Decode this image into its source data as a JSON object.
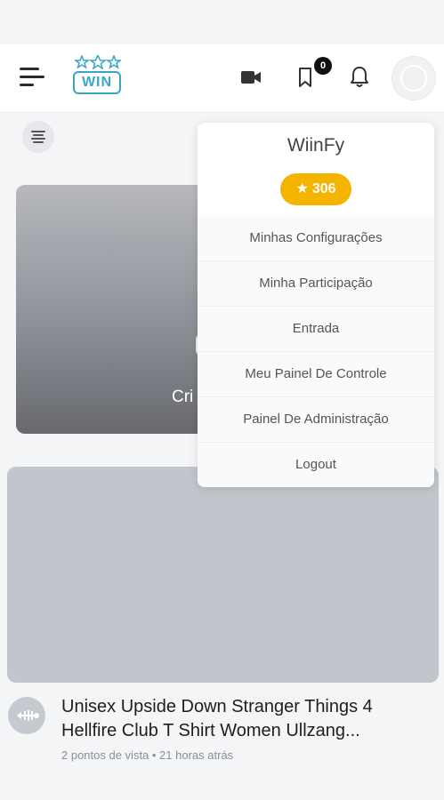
{
  "header": {
    "logo_text": "WIN",
    "notification_count": "0"
  },
  "feed": {
    "card1_text": "Cri",
    "post": {
      "title": "Unisex Upside Down Stranger Things 4 Hellfire Club T Shirt Women Ullzang...",
      "meta": "2 pontos de vista • 21 horas atrás"
    }
  },
  "user_menu": {
    "username": "WiinFy",
    "points": "306",
    "items": [
      {
        "label": "Minhas Configurações"
      },
      {
        "label": "Minha Participação"
      },
      {
        "label": "Entrada"
      },
      {
        "label": "Meu Painel De Controle"
      },
      {
        "label": "Painel De Administração"
      },
      {
        "label": "Logout"
      }
    ]
  },
  "colors": {
    "brand": "#3aa6c6",
    "points_badge": "#f5b400",
    "badge_bg": "#111111"
  }
}
